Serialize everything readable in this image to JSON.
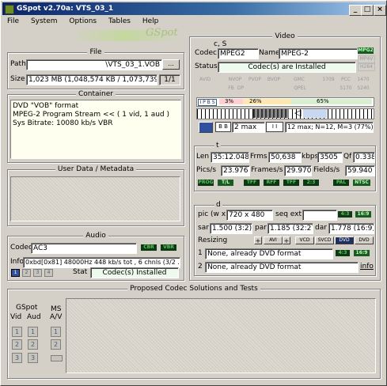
{
  "window": {
    "title": "GSpot v2.70a: VTS_03_1"
  },
  "menu": [
    "File",
    "System",
    "Options",
    "Tables",
    "Help"
  ],
  "logo_text": "GSpot",
  "file": {
    "title": "File",
    "path_label": "Path",
    "path_value": "\\VTS_03_1.VOB",
    "browse_label": "...",
    "size_label": "Size",
    "size_value": "1,023 MB (1,048,574 KB / 1,073,739,77",
    "part_value": "1/1"
  },
  "container": {
    "title": "Container",
    "lines": [
      "DVD \"VOB\" format",
      "MPEG-2 Program Stream << ( 1 vid, 1 aud )",
      "Sys Bitrate: 10080 kb/s VBR"
    ]
  },
  "userdata": {
    "title": "User Data / Metadata"
  },
  "audio": {
    "title": "Audio",
    "codec_label": "Codec",
    "codec_value": "AC3",
    "ind_cbr": "CBR",
    "ind_vbr": "VBR",
    "info_label": "Info",
    "info_value": "0xbd[0x81] 48000Hz  448 kb/s tot , 6 chnls (3/2 .1)",
    "stream_buttons": [
      "1",
      "2",
      "3",
      "4"
    ],
    "stat_label": "Stat",
    "stat_value": "Codec(s) Installed"
  },
  "proposed": {
    "title": "Proposed Codec Solutions and Tests",
    "gspot_label": "GSpot",
    "vid_label": "Vid",
    "aud_label": "Aud",
    "ms_label": "MS",
    "av_label": "A/V",
    "vid_buttons": [
      "1",
      "2",
      "3"
    ],
    "aud_buttons": [
      "1",
      "2",
      "3"
    ],
    "ms_buttons": [
      "1",
      "2"
    ]
  },
  "video": {
    "title": "Video",
    "cs_label": "c, S",
    "codec_label": "Codec",
    "codec_value": "MPEG2",
    "name_label": "Name",
    "name_value": "MPEG-2",
    "fmt_tags": [
      "MPG2",
      "MP4V",
      "H264"
    ],
    "status_label": "Status",
    "status_value": "Codec(s) are Installed",
    "tags_row1": [
      "AVID",
      "NVOP",
      "PVOP",
      "BVOP",
      "GMC",
      "1709",
      "PCC",
      "1470"
    ],
    "tags_row2": [
      "FB",
      "DP",
      "QPEL",
      "5170",
      "5240"
    ],
    "pct1": "3%",
    "pct2": "26%",
    "pct3": "65%",
    "bvops_label": "2 max",
    "gop_label": "12 max; N=12, M=3 (77%)",
    "len_label": "Len",
    "len_value": "35:12.048",
    "frms_label": "Frms",
    "frms_value": "50,638",
    "kbps_label": "kbps",
    "kbps_value": "3505",
    "qf_label": "Qf",
    "qf_value": "0.338",
    "pics_label": "Pics/s",
    "pics_value": "23.976",
    "frames_label": "Frames/s",
    "frames_value": "29.970",
    "fields_label": "Fields/s",
    "fields_value": "59.940",
    "flags": [
      "PROG",
      "T/L",
      "TFF",
      "RFF",
      "TFF",
      "2:3",
      "PAL",
      "NTSC"
    ],
    "d_label": "d",
    "pic_label": "pic (w x",
    "pic_value": "720 x 480",
    "seqext_label": "seq ext",
    "ar_tags": [
      "4:3",
      "16:9"
    ],
    "sar_label": "sar",
    "sar_value": "1.500 (3:2)",
    "par_label": "par",
    "par_value": "1.185 (32:27)",
    "dar_label": "dar",
    "dar_value": "1.778 (16:9)",
    "resizing_label": "Resizing",
    "resize_buttons": [
      "AVI",
      "VCD",
      "SVCD",
      "DVD",
      "DVD"
    ],
    "resize1_value": "None, already DVD format",
    "resize2_value": "None, already DVD format",
    "resize_tags": [
      "4:3",
      "16:9"
    ],
    "info_link": "info",
    "row1_label": "1",
    "row2_label": "2"
  },
  "colors": {
    "title_start": "#0a246a",
    "indicator": "#0b3a13",
    "indicator_text": "#5fbf5f"
  }
}
